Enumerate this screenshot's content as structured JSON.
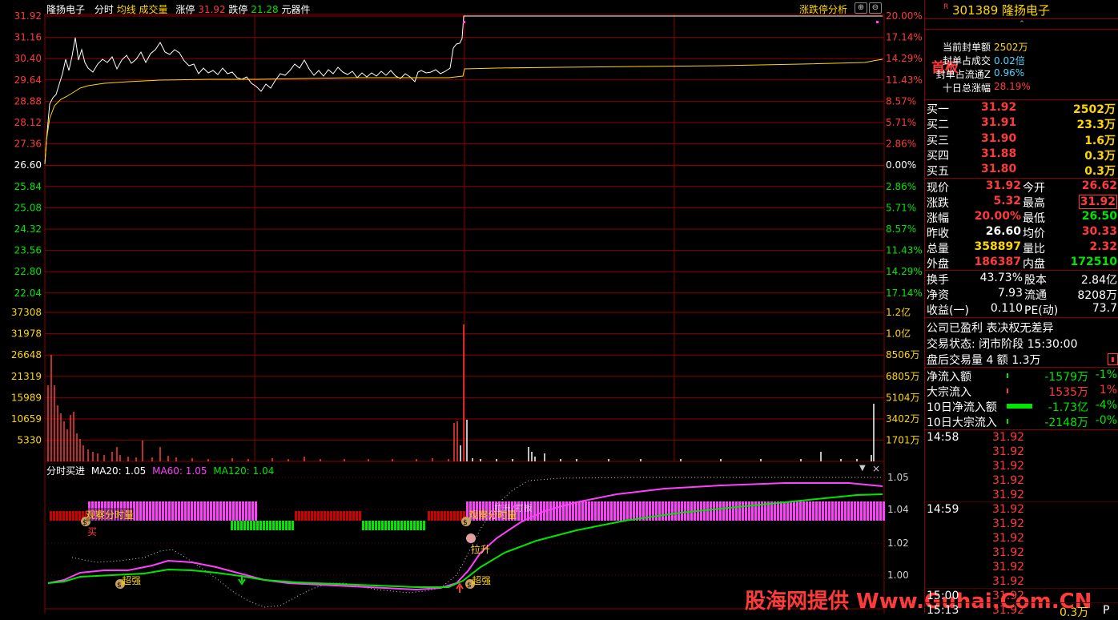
{
  "header": {
    "stock_name": "隆扬电子",
    "tab_timeshare": "分时",
    "tab_avgline": "均线",
    "tab_volume": "成交量",
    "limit_up_label": "涨停",
    "limit_up_value": "31.92",
    "limit_down_label": "跌停",
    "limit_down_value": "21.28",
    "sector": "元器件",
    "right_button": "涨跌停分析"
  },
  "price_axis_left": [
    "31.92",
    "31.16",
    "30.40",
    "29.64",
    "28.88",
    "28.12",
    "27.36",
    "26.60",
    "25.84",
    "25.08",
    "24.32",
    "23.56",
    "22.80",
    "22.04"
  ],
  "price_axis_right": [
    "20.00%",
    "17.14%",
    "14.29%",
    "11.43%",
    "8.57%",
    "5.71%",
    "2.86%",
    "0.00%",
    "2.86%",
    "5.71%",
    "8.57%",
    "11.43%",
    "14.29%",
    "17.14%"
  ],
  "volume_axis_left": [
    "37308",
    "31978",
    "26648",
    "21319",
    "15989",
    "10659",
    "5330"
  ],
  "volume_axis_right": [
    "1.2亿",
    "1.0亿",
    "8506万",
    "6805万",
    "5104万",
    "3402万",
    "1701万"
  ],
  "indicator": {
    "title": "分时买进",
    "ma20_label": "MA20: 1.05",
    "ma60_label": "MA60: 1.05",
    "ma120_label": "MA120: 1.04",
    "axis": [
      "1.05",
      "1.04",
      "1.02",
      "1.00"
    ],
    "annotations": {
      "watch1": "观察分时量",
      "buy": "买",
      "strong1": "超强",
      "watch2": "观察分时量",
      "pull": "拉升",
      "strong2": "超强",
      "bank_chars": "拉升/打板"
    },
    "colors": {
      "ma20": "#ffffff",
      "ma60": "#ff40ff",
      "ma120": "#00e600"
    }
  },
  "panel": {
    "badge": "R",
    "code": "301389",
    "name": "隆扬电子",
    "first_board": "首板",
    "seal_lines": [
      {
        "label": "当前封单额",
        "value": "2502万"
      },
      {
        "label": "封单占成交",
        "value": "0.02倍"
      },
      {
        "label": "封单占流通Z",
        "value": "0.96%"
      },
      {
        "label": "十日总涨幅",
        "value": "28.19%"
      }
    ],
    "bids": [
      {
        "label": "买一",
        "price": "31.92",
        "vol": "2502万"
      },
      {
        "label": "买二",
        "price": "31.91",
        "vol": "23.3万"
      },
      {
        "label": "买三",
        "price": "31.90",
        "vol": "1.6万"
      },
      {
        "label": "买四",
        "price": "31.88",
        "vol": "0.3万"
      },
      {
        "label": "买五",
        "price": "31.80",
        "vol": "0.3万"
      }
    ],
    "quote": [
      {
        "l1": "现价",
        "v1": "31.92",
        "l2": "今开",
        "v2": "26.62"
      },
      {
        "l1": "涨跌",
        "v1": "5.32",
        "l2": "最高",
        "v2": "31.92"
      },
      {
        "l1": "涨幅",
        "v1": "20.00%",
        "l2": "最低",
        "v2": "26.50"
      },
      {
        "l1": "昨收",
        "v1": "26.60",
        "l2": "均价",
        "v2": "30.33"
      },
      {
        "l1": "总量",
        "v1": "358897",
        "l2": "量比",
        "v2": "2.32"
      },
      {
        "l1": "外盘",
        "v1": "186387",
        "l2": "内盘",
        "v2": "172510"
      }
    ],
    "fund": [
      {
        "l1": "换手",
        "v1": "43.73%",
        "l2": "股本",
        "v2": "2.84亿"
      },
      {
        "l1": "净资",
        "v1": "7.93",
        "l2": "流通",
        "v2": "8208万"
      },
      {
        "l1": "收益(一)",
        "v1": "0.110",
        "l2": "PE(动)",
        "v2": "73.7"
      }
    ],
    "company_note": "公司已盈利 表决权无差异",
    "trade_status": "交易状态: 闭市阶段 15:30:00",
    "after_hours": "盘后交易量 4 额 1.3万",
    "flows": [
      {
        "label": "净流入额",
        "value": "-1579万",
        "pct": "-1%"
      },
      {
        "label": "大宗流入",
        "value": "1535万",
        "pct": "1%"
      },
      {
        "label": "10日净流入额",
        "value": "-1.73亿",
        "pct": "-4%"
      },
      {
        "label": "10日大宗流入",
        "value": "-2148万",
        "pct": "-0%"
      }
    ],
    "ticks": [
      {
        "time": "14:58",
        "prices": [
          "31.92",
          "31.92",
          "31.92",
          "31.92",
          "31.92"
        ]
      },
      {
        "time": "14:59",
        "prices": [
          "31.92",
          "31.92",
          "31.92",
          "31.92",
          "31.92",
          "31.92"
        ]
      },
      {
        "time": "15:00",
        "prices": [
          "31.92"
        ]
      },
      {
        "time": "15:13",
        "prices": [
          "31.92"
        ],
        "vol": "0.3万",
        "flag": "P"
      }
    ]
  },
  "watermark": "股海网提供 Www.Guhai.Com.CN"
}
